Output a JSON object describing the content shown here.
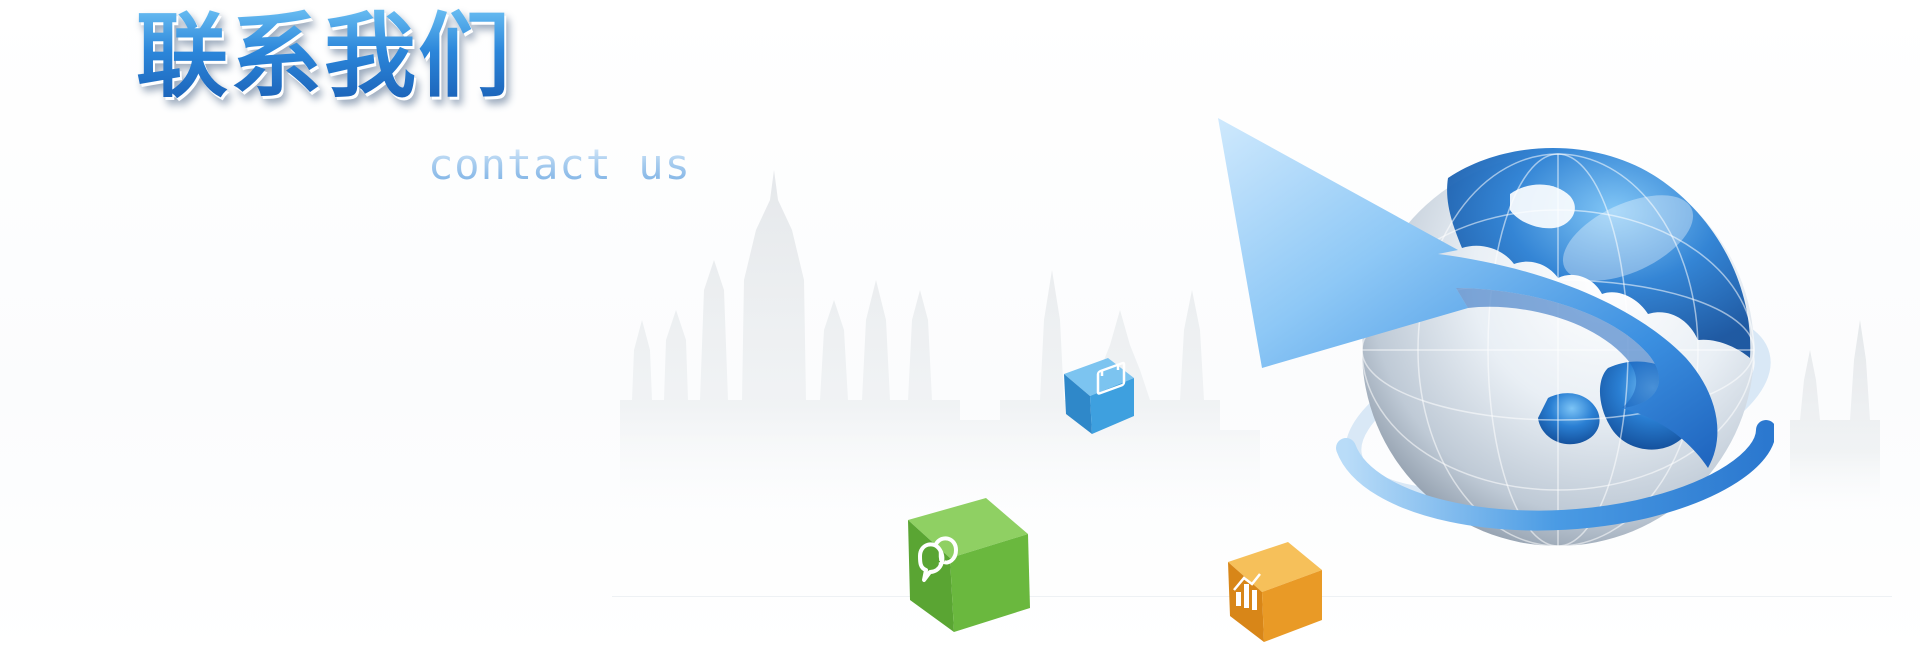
{
  "banner": {
    "title": "联系我们",
    "subtitle": "contact us"
  },
  "colors": {
    "title_blue": "#2b86da",
    "subtitle_blue": "#a8cdef",
    "arrow_blue": "#3b8fe0",
    "globe_ocean": "#2a7fd3",
    "cube_green": "#6ab83e",
    "cube_blue": "#3ea0df",
    "cube_orange": "#e99a26",
    "skyline_gray": "#e9ecee"
  },
  "icons": {
    "globe": "globe-icon",
    "arrow": "orbit-arrow-icon",
    "chat": "chat-bubble-icon",
    "calendar": "calendar-icon",
    "chart": "bar-chart-icon"
  }
}
